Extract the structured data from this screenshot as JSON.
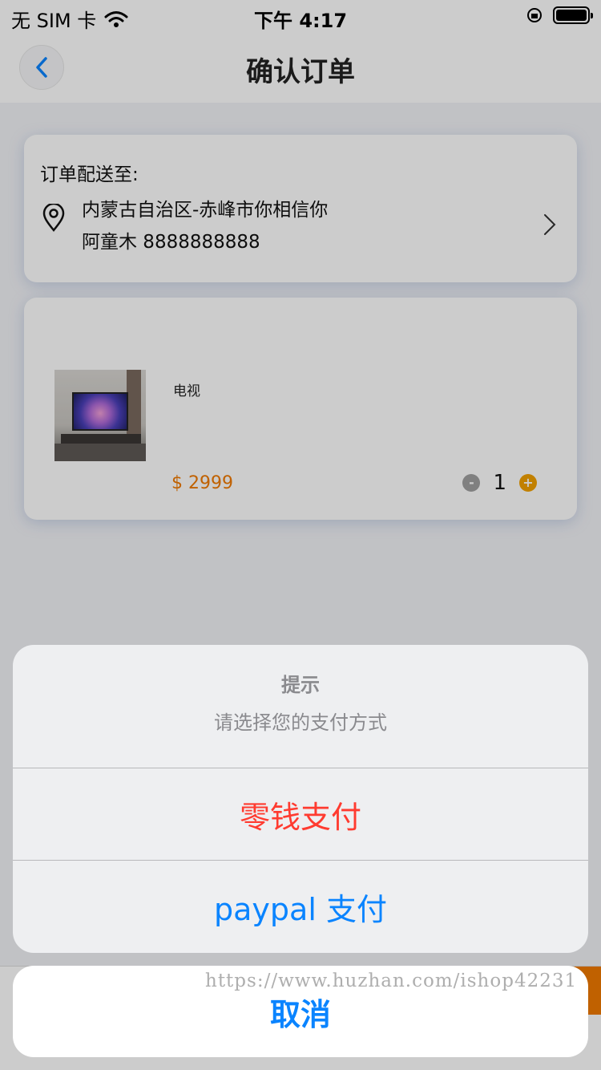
{
  "status": {
    "carrier": "无 SIM 卡",
    "time": "下午 4:17"
  },
  "nav": {
    "title": "确认订单"
  },
  "address": {
    "label": "订单配送至:",
    "line1": "内蒙古自治区-赤峰市你相信你",
    "line2": "阿童木 8888888888"
  },
  "item": {
    "name": "电视",
    "price": "$ 2999",
    "quantity": "1",
    "minus_symbol": "-",
    "plus_symbol": "+"
  },
  "colors": {
    "accent": "#f07a00",
    "destructive": "#ff3b30",
    "action": "#0a84ff"
  },
  "action_sheet": {
    "title": "提示",
    "message": "请选择您的支付方式",
    "options": [
      "零钱支付",
      "paypal 支付"
    ],
    "cancel": "取消"
  },
  "watermark": "https://www.huzhan.com/ishop42231"
}
